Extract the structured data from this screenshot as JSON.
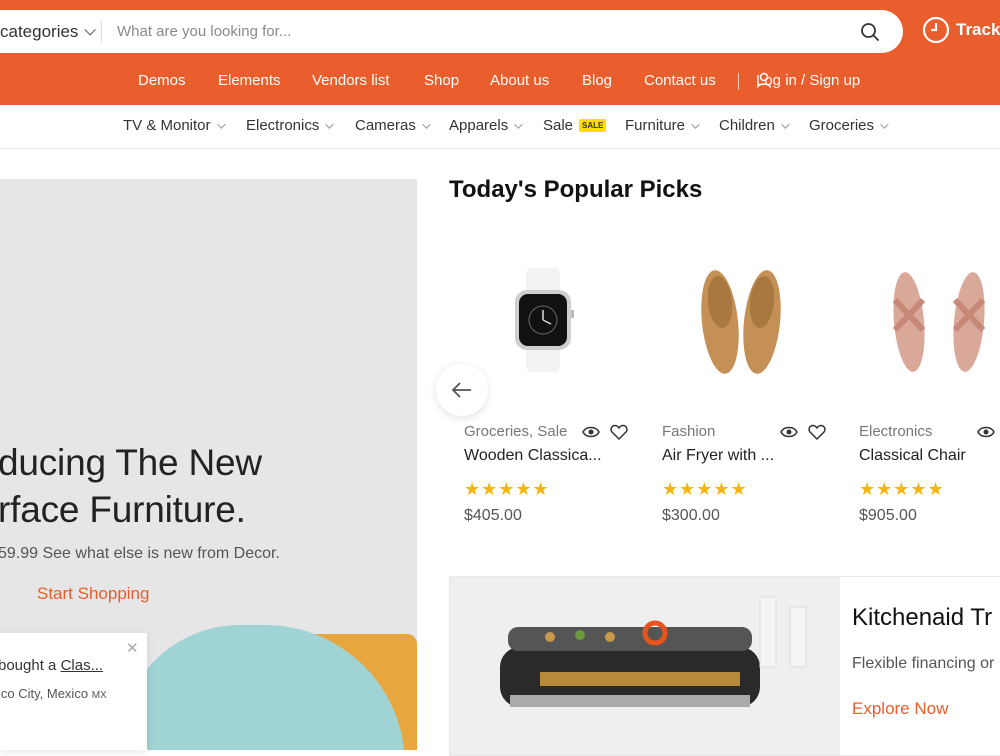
{
  "search": {
    "category_label": "categories",
    "placeholder": "What are you looking for..."
  },
  "track_label": "Track",
  "main_nav": {
    "items": [
      "Demos",
      "Elements",
      "Vendors list",
      "Shop",
      "About us",
      "Blog",
      "Contact us"
    ],
    "login_label": "Log in / Sign up"
  },
  "category_nav": {
    "items": [
      "TV & Monitor",
      "Electronics",
      "Cameras",
      "Apparels",
      "Sale",
      "Furniture",
      "Children",
      "Groceries"
    ],
    "sale_badge": "SALE"
  },
  "hero": {
    "title_line1": "ducing The New",
    "title_line2": "rface Furniture.",
    "subtitle": "59.99 See what else is new from Decor.",
    "cta": "Start Shopping"
  },
  "toast": {
    "text_prefix": "bought a ",
    "product_link": "Clas...",
    "location": "ico City, Mexico",
    "country_code": "MX"
  },
  "popular": {
    "title": "Today's Popular Picks",
    "products": [
      {
        "category": "Groceries, Sale",
        "name": "Wooden Classica...",
        "stars": "★★★★★",
        "price": "$405.00"
      },
      {
        "category": "Fashion",
        "name": "Air Fryer with ...",
        "stars": "★★★★★",
        "price": "$300.00"
      },
      {
        "category": "Electronics",
        "name": "Classical Chair",
        "stars": "★★★★★",
        "price": "$905.00"
      }
    ]
  },
  "banner": {
    "title": "Kitchenaid Tr",
    "subtitle": "Flexible financing or",
    "cta": "Explore Now"
  },
  "colors": {
    "brand": "#ea5d2c",
    "star": "#f5b50a",
    "sale_badge": "#ffdd00"
  },
  "icons": [
    "chevron-down-icon",
    "search-icon",
    "clock-icon",
    "user-icon",
    "eye-icon",
    "heart-icon",
    "arrow-left-icon",
    "close-icon"
  ]
}
